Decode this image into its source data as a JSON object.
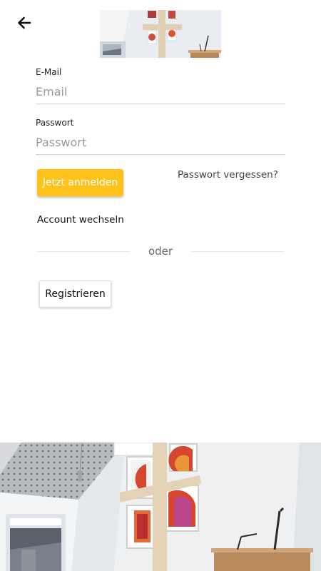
{
  "header": {
    "back_icon": "arrow-left-icon",
    "photo": "church-interior-photo"
  },
  "form": {
    "email": {
      "label": "E-Mail",
      "placeholder": "Email",
      "value": ""
    },
    "password": {
      "label": "Passwort",
      "placeholder": "Passwort",
      "value": ""
    }
  },
  "actions": {
    "login_label": "Jetzt anmelden",
    "forgot_label": "Passwort vergessen?",
    "switch_account_label": "Account wechseln",
    "divider_label": "oder",
    "register_label": "Registrieren"
  },
  "colors": {
    "accent": "#ffc21a",
    "background": "#ffffff"
  },
  "footer": {
    "photo": "church-interior-photo"
  }
}
